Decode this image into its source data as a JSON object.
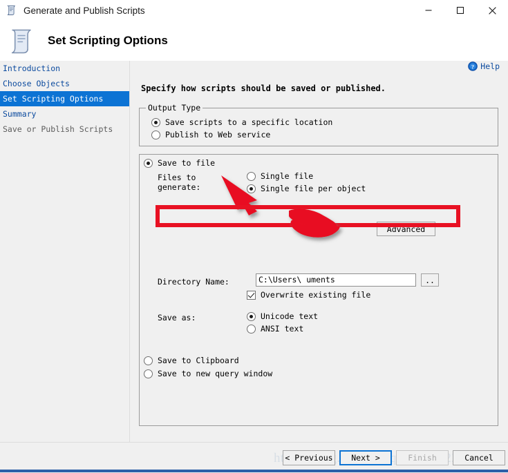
{
  "window": {
    "title": "Generate and Publish Scripts",
    "icon": "script-scroll-icon",
    "controls": {
      "minimize": "minimize-icon",
      "maximize": "maximize-icon",
      "close": "close-icon"
    }
  },
  "header": {
    "icon": "script-scroll-icon",
    "title": "Set Scripting Options"
  },
  "sidebar": {
    "items": [
      {
        "label": "Introduction",
        "state": "done"
      },
      {
        "label": "Choose Objects",
        "state": "done"
      },
      {
        "label": "Set Scripting Options",
        "state": "selected"
      },
      {
        "label": "Summary",
        "state": "done"
      },
      {
        "label": "Save or Publish Scripts",
        "state": "future"
      }
    ]
  },
  "content": {
    "help": {
      "label": "Help",
      "icon": "help-question-icon"
    },
    "instruction": "Specify how scripts should be saved or published.",
    "output_type": {
      "legend": "Output Type",
      "options": [
        {
          "label": "Save scripts to a specific location",
          "checked": true
        },
        {
          "label": "Publish to Web service",
          "checked": false
        }
      ]
    },
    "save_options": {
      "save_to_file": {
        "label": "Save to file",
        "checked": true
      },
      "advanced_button": "Advanced",
      "files_to_generate": {
        "label_line1": "Files to",
        "label_line2": "generate:",
        "options": [
          {
            "label": "Single file",
            "checked": false
          },
          {
            "label": "Single file per object",
            "checked": true
          }
        ]
      },
      "directory": {
        "label": "Directory Name:",
        "value": "C:\\Users\\          uments",
        "browse_label": ".."
      },
      "overwrite": {
        "label": "Overwrite existing file",
        "checked": true
      },
      "save_as": {
        "label": "Save as:",
        "options": [
          {
            "label": "Unicode text",
            "checked": true
          },
          {
            "label": "ANSI text",
            "checked": false
          }
        ]
      },
      "other_targets": [
        {
          "label": "Save to Clipboard",
          "checked": false
        },
        {
          "label": "Save to new query window",
          "checked": false
        }
      ]
    }
  },
  "annotations": {
    "arrow": "red-arrow-pointing-to-single-file-per-object",
    "rectangle": "red-rectangle-around-directory-name-row",
    "scribble": "red-scribble-masking-username-in-path",
    "color": "#E81123"
  },
  "footer": {
    "watermark": "https://blog.csdn.net/qq_36300228",
    "buttons": [
      {
        "label": "< Previous",
        "state": "enabled"
      },
      {
        "label": "Next >",
        "state": "default"
      },
      {
        "label": "Finish",
        "state": "disabled"
      },
      {
        "label": "Cancel",
        "state": "enabled"
      }
    ]
  }
}
